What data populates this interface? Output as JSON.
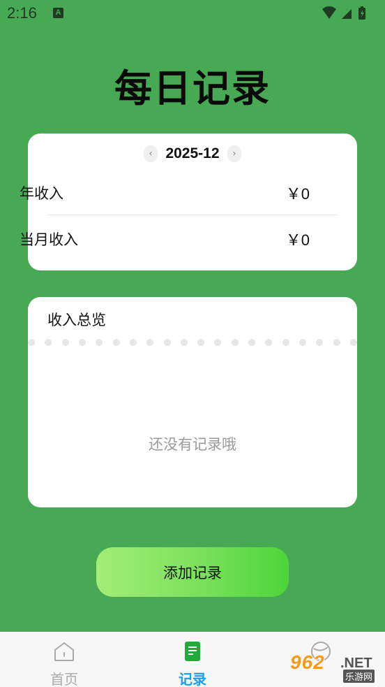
{
  "status_bar": {
    "time": "2:16",
    "notification_icon": "A"
  },
  "page": {
    "title": "每日记录"
  },
  "summary": {
    "month": "2025-12",
    "prev_icon": "chevron-left-icon",
    "next_icon": "chevron-right-icon",
    "year_income_label": "年收入",
    "year_income_value": "￥0",
    "month_income_label": "当月收入",
    "month_income_value": "￥0"
  },
  "overview": {
    "title": "收入总览",
    "empty_text": "还没有记录哦"
  },
  "actions": {
    "add_label": "添加记录"
  },
  "tabbar": {
    "tabs": [
      {
        "label": "首页",
        "icon": "home-icon"
      },
      {
        "label": "记录",
        "icon": "document-icon"
      },
      {
        "label": "",
        "icon": "stats-icon"
      }
    ]
  },
  "watermark": {
    "number": "962",
    "suffix": ".NET",
    "cn": "乐游网"
  },
  "colors": {
    "background": "#48a955",
    "accent": "#1aa0e8",
    "record_icon": "#1faa3a"
  }
}
